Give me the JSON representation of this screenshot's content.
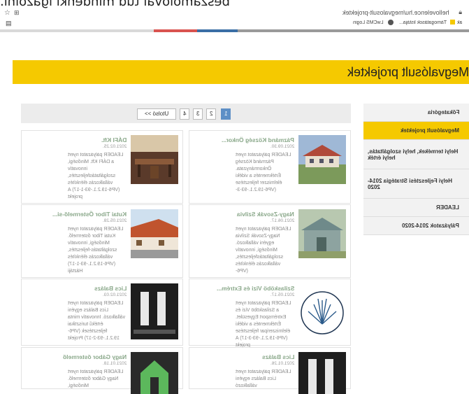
{
  "caption": "beszámolóval tud mindenki igazolni.",
  "browser": {
    "url": "hellovelence.hu/megvalosult-projektek",
    "bookmarks": [
      "Támogatások listája...",
      "LwCMS Login"
    ]
  },
  "colors": {
    "accent": "#f5c900",
    "link_blue": "#5d8fc6",
    "bar": [
      "#3a6ea5",
      "#d9534f",
      "#888888",
      "#aaaaaa"
    ]
  },
  "banner": {
    "title": "Megvalósult projektek"
  },
  "sidebar": {
    "items": [
      {
        "label": "Főkategória",
        "active": false
      },
      {
        "label": "Megvalósult projektek",
        "active": true
      },
      {
        "label": "Helyi termékek, helyi szolgáltatás, helyi érték",
        "active": false
      },
      {
        "label": "Helyi Fejlesztési Stratégia 2014-2020",
        "active": false
      },
      {
        "label": "LEADER",
        "active": false
      },
      {
        "label": "Pályázatok 2014-2020",
        "active": false
      }
    ]
  },
  "pagination": {
    "pages": [
      "1",
      "2",
      "3",
      "4"
    ],
    "last": "Utolsó >>",
    "current": "1"
  },
  "cards": [
    {
      "title": "Pázmánd Község Önkor...",
      "date": "2021.09.30.",
      "excerpt": "LEADER pályázatot nyert Pázmánd Község Önkormányzata. Értékmentés a vidéki élelmiszer fejlesztése (VP6-19.2.1.-93-3-"
    },
    {
      "title": "DÁFI Kft.",
      "date": "2021.02.25.",
      "excerpt": "LEADER pályázatot nyert a DÁFI Kft. Minőségi, innovatív szolgáltatásfejlesztés, vállalkozás élénkítés (VP6-19.2.1.-93-1-17) A projekt"
    },
    {
      "title": "Nagy-Zsovák Szilvia",
      "date": "2021.06.17.",
      "excerpt": "LEADER pályázatot nyert Nagy-Zsovák Szilvia egyéni vállalkozó. Minőségi, innovatív szolgáltatásfejlesztés, vállalkozás élénkítés (VP6-"
    },
    {
      "title": "Kutai Tibor Őstermelő-si...",
      "date": "2021.05.28.",
      "excerpt": "LEADER pályázatot nyert Kutai Tibor őstermelő. Minőségi, innovatív szolgáltatás-fejlesztés, vállalkozás élénkítés (VP6-19.2.1.-93-1-17) Háztáji"
    },
    {
      "title": "Szilasköbö Vizi és Extrém...",
      "date": "2021.05.17.",
      "excerpt": "LEADER pályázatot nyert a Szilasköbö Vizi és Extrémsport Egyesület. Értékmentés a vidéki élelmiszeripar fejlesztése (VP6-19.2.1.-93-3-17) A projekt"
    },
    {
      "title": "Lics Balázs",
      "date": "2021.02.03.",
      "excerpt": "LEADER pályázatot nyert Lics Balázs egyéni vállalkozó. Innovatív minta értékű turisztikai fejlesztések (VP6-19.2.1.-93-2-17) Projekt"
    },
    {
      "title": "Lics Balázs",
      "date": "2021.01.26.",
      "excerpt": "LEADER pályázatot nyert Lics Balázs egyéni vállalkozó"
    },
    {
      "title": "Nagy Gábor őstermelő",
      "date": "2021.01.18.",
      "excerpt": "LEADER pályázatot nyert Nagy Gábor őstermelő. Minőségi,"
    }
  ]
}
